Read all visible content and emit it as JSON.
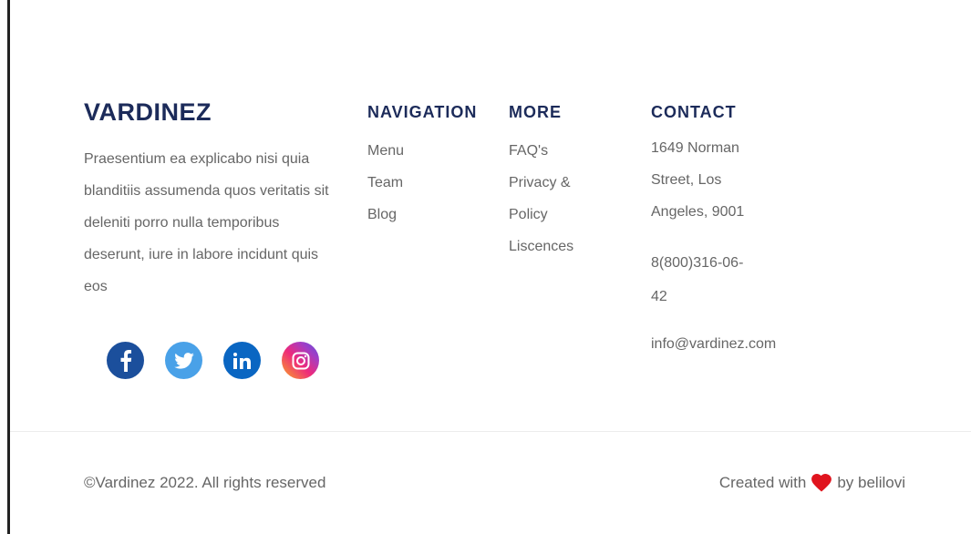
{
  "footer": {
    "brand": "VARDINEZ",
    "about": "Praesentium ea explicabo nisi quia blanditiis assumenda quos veritatis sit deleniti porro nulla temporibus deserunt, iure in labore incidunt quis eos",
    "social": [
      {
        "name": "facebook-icon"
      },
      {
        "name": "twitter-icon"
      },
      {
        "name": "linkedin-icon"
      },
      {
        "name": "instagram-icon"
      }
    ],
    "navigation": {
      "title": "NAVIGATION",
      "items": [
        "Menu",
        "Team",
        "Blog"
      ]
    },
    "more": {
      "title": "MORE",
      "items": [
        "FAQ's",
        "Privacy & Policy",
        "Liscences"
      ]
    },
    "contact": {
      "title": "CONTACT",
      "address": "1649 Norman Street, Los Angeles, 9001",
      "phone": "8(800)316-06-42",
      "email": "info@vardinez.com"
    },
    "copyright": "©Vardinez 2022. All rights reserved",
    "credits": {
      "before": "Created with",
      "after": "by belilovi",
      "heart_color": "#e0141e"
    }
  }
}
